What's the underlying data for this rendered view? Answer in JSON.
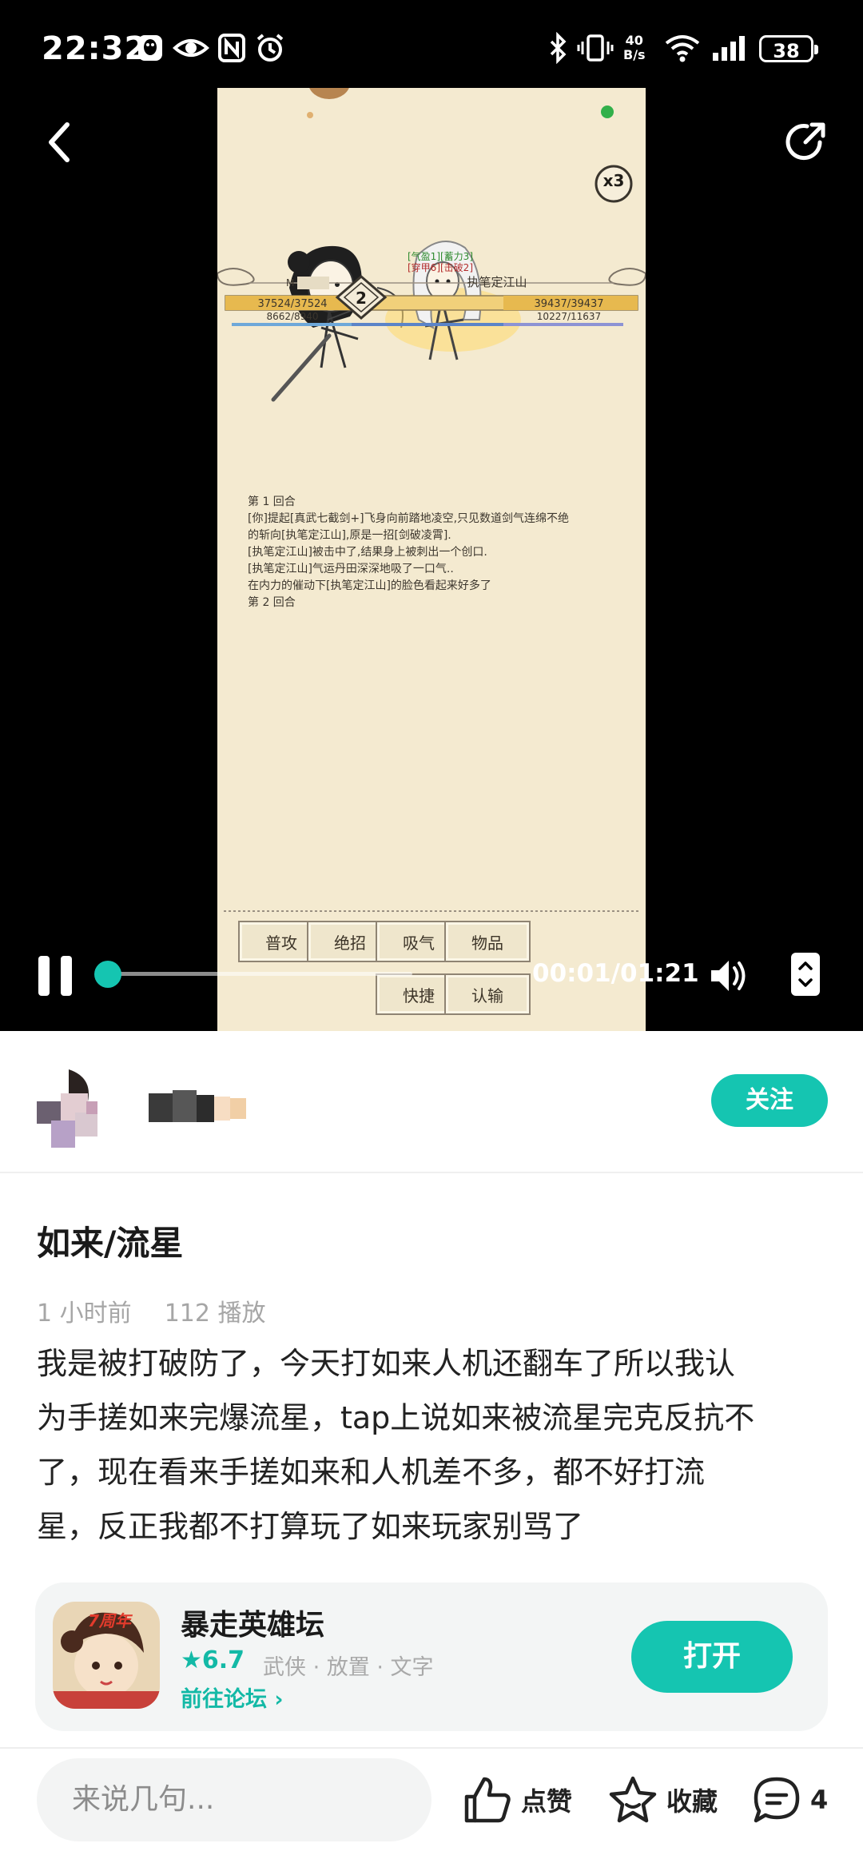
{
  "status_bar": {
    "time": "22:32",
    "net_speed_top": "40",
    "net_speed_bottom": "B/s",
    "battery": "38"
  },
  "video": {
    "speed_badge": "x3",
    "round_badge": "2",
    "player_hp": "37524/37524",
    "player_mp": "8662/8940",
    "enemy_name": "执笔定江山",
    "enemy_hp": "39437/39437",
    "enemy_mp": "10227/11637",
    "buff_line1": "[气盈1][蓄力3]",
    "buff_line2": "[穿甲6][击破2]",
    "battle_log": [
      "第 1 回合",
      "[你]提起[真武七截剑+]飞身向前踏地凌空,只见数道剑气连绵不绝",
      "的斩向[执笔定江山],原是一招[剑破凌霄].",
      "[执笔定江山]被击中了,结果身上被刺出一个创口.",
      "[执笔定江山]气运丹田深深地吸了一口气..",
      "在内力的催动下[执笔定江山]的脸色看起来好多了",
      "第 2 回合"
    ],
    "buttons": {
      "attack": "普攻",
      "skill": "绝招",
      "breathe": "吸气",
      "item": "物品",
      "shortcut": "快捷",
      "surrender": "认输"
    },
    "playback": {
      "time": "00:01/01:21",
      "progress": 0.012
    }
  },
  "author": {
    "follow_label": "关注"
  },
  "post": {
    "title": "如来/流星",
    "time_ago": "1 小时前",
    "views": "112 播放",
    "body_lines": [
      "我是被打破防了，今天打如来人机还翻车了所以我认",
      "为手搓如来完爆流星，tap上说如来被流星完克反抗不",
      "了，现在看来手搓如来和人机差不多，都不好打流",
      "星，反正我都不打算玩了如来玩家别骂了"
    ]
  },
  "app_card": {
    "name": "暴走英雄坛",
    "rating": "★6.7",
    "tags": "武侠 · 放置 · 文字",
    "forum_link": "前往论坛 ›",
    "open_label": "打开",
    "icon_badge": "7周年"
  },
  "bottom_bar": {
    "comment_placeholder": "来说几句...",
    "like_label": "点赞",
    "favorite_label": "收藏",
    "comment_count": "4"
  },
  "colors": {
    "accent": "#15c5b1",
    "video_bg": "#000000",
    "game_bg": "#f4ead0"
  }
}
